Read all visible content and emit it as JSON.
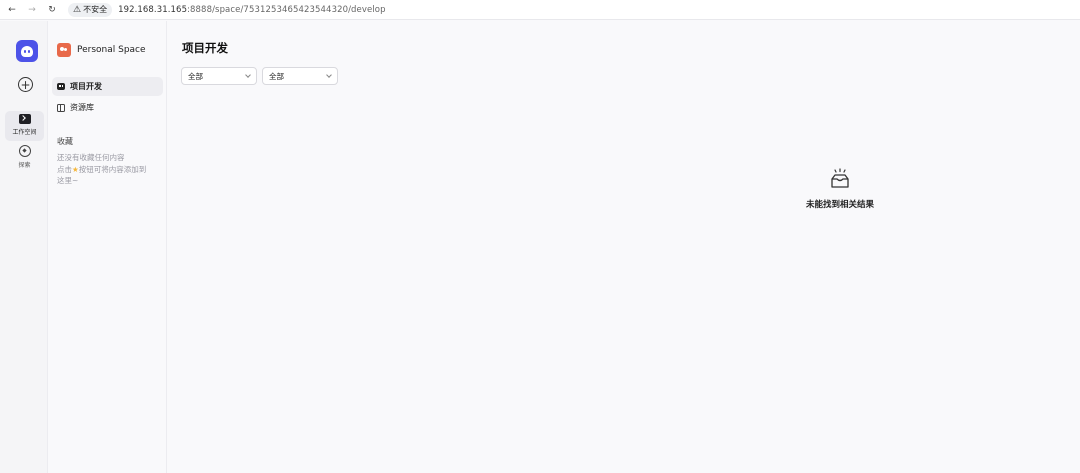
{
  "browser": {
    "security_label": "不安全",
    "url_host": "192.168.31.165",
    "url_rest": ":8888/space/7531253465423544320/develop"
  },
  "rail": {
    "workspace_label": "工作空间",
    "explore_label": "探索"
  },
  "sidebar": {
    "space_name": "Personal Space",
    "items": [
      {
        "label": "项目开发",
        "icon": "bot-icon",
        "active": true
      },
      {
        "label": "资源库",
        "icon": "library-icon",
        "active": false
      }
    ],
    "favorites_title": "收藏",
    "favorites_empty_line1": "还没有收藏任何内容",
    "favorites_empty_line2_a": "点击",
    "favorites_empty_line2_b": "按钮可将内容添加到",
    "favorites_empty_line3": "这里~"
  },
  "main": {
    "title": "项目开发",
    "filters": [
      {
        "value": "全部"
      },
      {
        "value": "全部"
      }
    ],
    "empty_text": "未能找到相关结果"
  },
  "colors": {
    "brand": "#4d53e8",
    "space_avatar": "#e8694a",
    "star": "#f5b73b"
  }
}
